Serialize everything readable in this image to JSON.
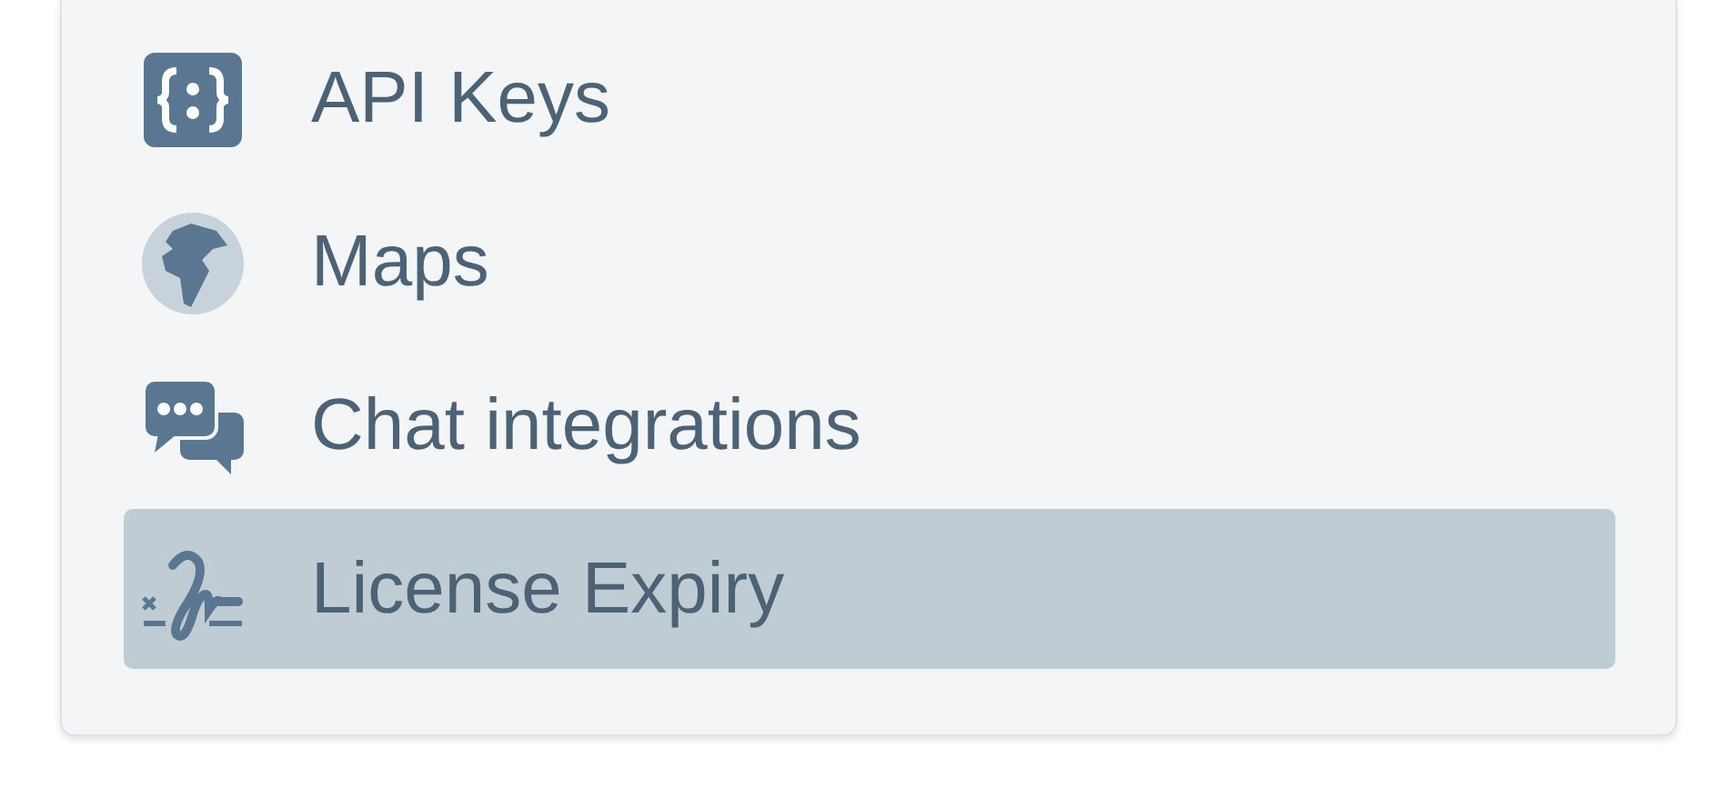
{
  "menu": {
    "items": [
      {
        "label": "API Keys",
        "selected": false
      },
      {
        "label": "Maps",
        "selected": false
      },
      {
        "label": "Chat integrations",
        "selected": false
      },
      {
        "label": "License Expiry",
        "selected": true
      }
    ]
  }
}
